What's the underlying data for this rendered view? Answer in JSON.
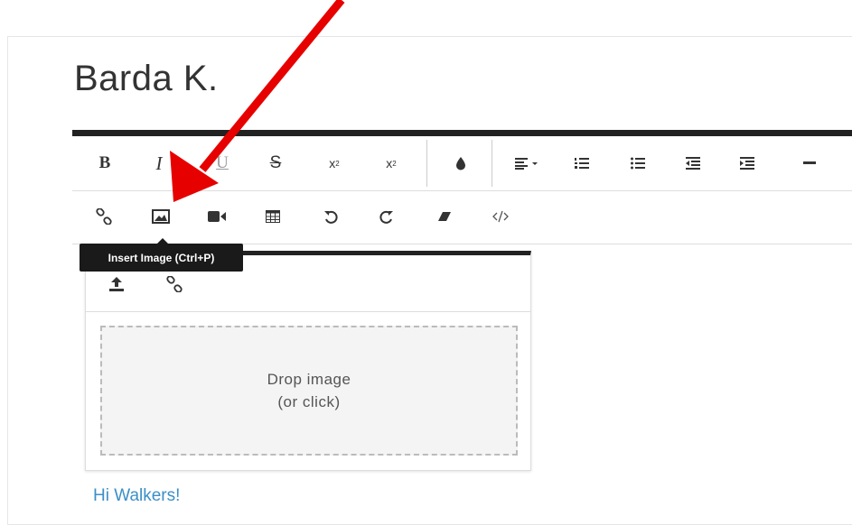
{
  "page": {
    "title": "Barda K."
  },
  "toolbar": {
    "row1": [
      {
        "name": "bold-button",
        "label": "B"
      },
      {
        "name": "italic-button",
        "label": "I"
      },
      {
        "name": "underline-button",
        "label": "U"
      },
      {
        "name": "strikethrough-button",
        "label": "S"
      },
      {
        "name": "subscript-button",
        "label": "x"
      },
      {
        "name": "superscript-button",
        "label": "x"
      }
    ],
    "subscript_mark": "2",
    "superscript_mark": "2"
  },
  "tooltip": {
    "text": "Insert Image (Ctrl+P)"
  },
  "image_popup": {
    "drop_line1": "Drop image",
    "drop_line2": "(or click)"
  },
  "editor": {
    "content": "Hi Walkers!"
  },
  "colors": {
    "annotation_arrow": "#e60000",
    "link_text": "#3c8fc7"
  }
}
